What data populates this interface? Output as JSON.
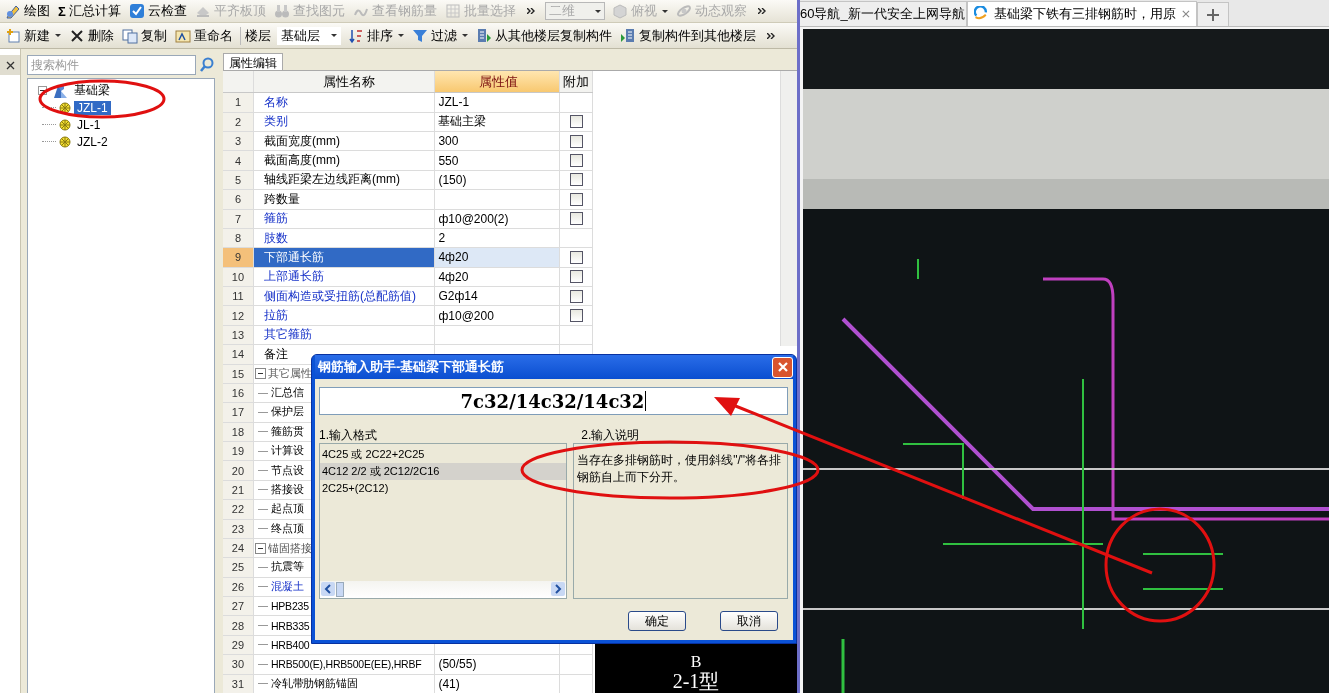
{
  "toolbar_main": [
    {
      "kind": "button",
      "label": "绘图",
      "disabled": false
    },
    {
      "kind": "button",
      "glyph": "Σ",
      "label": "汇总计算",
      "disabled": false
    },
    {
      "kind": "button",
      "label": "云检查",
      "disabled": false
    },
    {
      "kind": "button",
      "label": "平齐板顶",
      "disabled": true
    },
    {
      "kind": "button",
      "label": "查找图元",
      "disabled": true
    },
    {
      "kind": "button",
      "label": "查看钢筋量",
      "disabled": true
    },
    {
      "kind": "button",
      "label": "批量选择",
      "disabled": true
    },
    {
      "kind": "more"
    },
    {
      "kind": "select",
      "label": "二维",
      "disabled": true
    },
    {
      "kind": "button",
      "label": "俯视",
      "dropdown": true,
      "disabled": true
    },
    {
      "kind": "button",
      "label": "动态观察",
      "disabled": true
    },
    {
      "kind": "more"
    }
  ],
  "toolbar_component": [
    {
      "kind": "button",
      "label": "新建",
      "dropdown": true
    },
    {
      "kind": "button",
      "label": "删除"
    },
    {
      "kind": "button",
      "label": "复制"
    },
    {
      "kind": "button",
      "label": "重命名"
    },
    {
      "kind": "label",
      "label": "楼层"
    },
    {
      "kind": "select",
      "label": "基础层"
    },
    {
      "kind": "button",
      "label": "排序",
      "dropdown": true
    },
    {
      "kind": "button",
      "label": "过滤",
      "dropdown": true
    },
    {
      "kind": "button",
      "label": "从其他楼层复制构件"
    },
    {
      "kind": "button",
      "label": "复制构件到其他楼层"
    },
    {
      "kind": "more"
    }
  ],
  "tree": {
    "search": {
      "placeholder": "搜索构件"
    },
    "items": [
      {
        "label": "基础梁",
        "expanded": true,
        "selected": false,
        "children": [
          {
            "label": "JZL-1",
            "selected": true
          },
          {
            "label": "JL-1",
            "selected": false
          },
          {
            "label": "JZL-2",
            "selected": false
          }
        ]
      }
    ]
  },
  "properties": {
    "tab": {
      "label": "属性编辑",
      "selected": true
    },
    "columns": [
      "属性名称",
      "属性值",
      "附加"
    ],
    "rows": [
      {
        "index": "1",
        "kind": "link",
        "name": "名称",
        "value": "JZL-1",
        "selected": false
      },
      {
        "index": "2",
        "kind": "link",
        "name": "类别",
        "value": "基础主梁",
        "selected": false,
        "checkbox": {
          "checked": false
        }
      },
      {
        "index": "3",
        "kind": "plain",
        "name": "截面宽度(mm)",
        "value": "300",
        "selected": false,
        "checkbox": {
          "checked": false
        }
      },
      {
        "index": "4",
        "kind": "plain",
        "name": "截面高度(mm)",
        "value": "550",
        "selected": false,
        "checkbox": {
          "checked": false
        }
      },
      {
        "index": "5",
        "kind": "plain",
        "name": "轴线距梁左边线距离(mm)",
        "value": "(150)",
        "selected": false,
        "checkbox": {
          "checked": false
        }
      },
      {
        "index": "6",
        "kind": "plain",
        "name": "跨数量",
        "selected": false,
        "checkbox": {
          "checked": false
        }
      },
      {
        "index": "7",
        "kind": "link",
        "name": "箍筋",
        "value": "ф10@200(2)",
        "selected": false,
        "checkbox": {
          "checked": false
        }
      },
      {
        "index": "8",
        "kind": "link",
        "name": "肢数",
        "value": "2",
        "selected": false
      },
      {
        "index": "9",
        "kind": "link",
        "name": "下部通长筋",
        "value": "4ф20",
        "selected": true,
        "checkbox": {
          "checked": false
        }
      },
      {
        "index": "10",
        "kind": "link",
        "name": "上部通长筋",
        "value": "4ф20",
        "selected": false,
        "checkbox": {
          "checked": false
        }
      },
      {
        "index": "11",
        "kind": "link",
        "name": "侧面构造或受扭筋(总配筋值)",
        "value": "G2ф14",
        "selected": false,
        "checkbox": {
          "checked": false
        }
      },
      {
        "index": "12",
        "kind": "link",
        "name": "拉筋",
        "value": "ф10@200",
        "selected": false,
        "checkbox": {
          "checked": false
        }
      },
      {
        "index": "13",
        "kind": "link",
        "name": "其它箍筋",
        "selected": false
      },
      {
        "index": "14",
        "kind": "plain",
        "name": "备注",
        "selected": false
      },
      {
        "index": "15",
        "kind": "group",
        "name": "其它属性",
        "expanded": true,
        "selected": false
      },
      {
        "index": "16",
        "kind": "child",
        "name": "汇总信",
        "selected": false
      },
      {
        "index": "17",
        "kind": "child",
        "name": "保护层",
        "selected": false
      },
      {
        "index": "18",
        "kind": "child",
        "name": "箍筋贯",
        "selected": false
      },
      {
        "index": "19",
        "kind": "child",
        "name": "计算设",
        "selected": false
      },
      {
        "index": "20",
        "kind": "child",
        "name": "节点设",
        "selected": false
      },
      {
        "index": "21",
        "kind": "child",
        "name": "搭接设",
        "selected": false
      },
      {
        "index": "22",
        "kind": "child",
        "name": "起点顶",
        "selected": false
      },
      {
        "index": "23",
        "kind": "child",
        "name": "终点顶",
        "selected": false
      },
      {
        "index": "24",
        "kind": "group",
        "name": "锚固搭接",
        "expanded": true,
        "selected": false
      },
      {
        "index": "25",
        "kind": "child",
        "name": "抗震等",
        "selected": false
      },
      {
        "index": "26",
        "kind": "child-link",
        "name": "混凝土",
        "selected": false
      },
      {
        "index": "27",
        "kind": "child",
        "name": "HPB235",
        "selected": false
      },
      {
        "index": "28",
        "kind": "child",
        "name": "HRB335",
        "selected": false
      },
      {
        "index": "29",
        "kind": "child",
        "name": "HRB400",
        "selected": false
      },
      {
        "index": "30",
        "kind": "child",
        "name": "HRB500(E),HRB500E(EE),HRBF",
        "value": "(50/55)",
        "selected": false
      },
      {
        "index": "31",
        "kind": "child",
        "name": "冷轧带肋钢筋锚固",
        "value": "(41)",
        "selected": false
      }
    ]
  },
  "drawing_view": {
    "labels": [
      "B",
      "2-1型"
    ]
  },
  "dialog": {
    "title": "钢筋输入助手-基础梁下部通长筋",
    "input": {
      "value": "7c32/14c32/14c32"
    },
    "format_label": "1.输入格式",
    "formats": [
      {
        "text": "4C25 或 2C22+2C25",
        "selected": false
      },
      {
        "text": "4C12 2/2 或 2C12/2C16",
        "selected": true
      },
      {
        "text": "2C25+(2C12)",
        "selected": false
      }
    ],
    "help_label": "2.输入说明",
    "help": "当存在多排钢筋时，使用斜线\"/\"将各排钢筋自上而下分开。",
    "buttons": [
      "确定",
      "取消"
    ]
  },
  "browser": {
    "tabs": [
      {
        "title": "60导航_新一代安全上网导航",
        "selected": false
      },
      {
        "title": "基础梁下铁有三排钢筋时，用原",
        "selected": true
      }
    ]
  }
}
